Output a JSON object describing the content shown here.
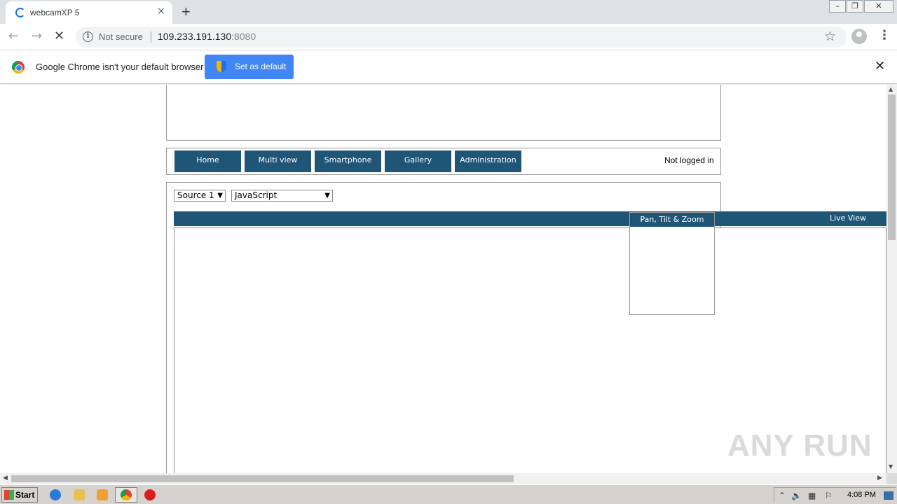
{
  "browser": {
    "tab_title": "webcamXP 5",
    "tab_close_icon": "×",
    "new_tab_icon": "+",
    "security_label": "Not secure",
    "url_host": "109.233.191.130",
    "url_port": ":8080"
  },
  "infobar": {
    "message": "Google Chrome isn't your default browser",
    "button_label": "Set as default",
    "close_icon": "✕"
  },
  "nav": {
    "items": [
      "Home",
      "Multi view",
      "Smartphone",
      "Gallery",
      "Administration"
    ],
    "login_status": "Not logged in"
  },
  "controls": {
    "source_select": "Source 1",
    "mode_select": "JavaScript"
  },
  "panel": {
    "live_view_label": "Live View",
    "ptz_label": "Pan, Tilt & Zoom"
  },
  "watermark": "ANY RUN",
  "taskbar": {
    "start_label": "Start",
    "clock": "4:08 PM"
  },
  "colors": {
    "nav_accent": "#1f5577",
    "chrome_blue": "#4285f4"
  }
}
